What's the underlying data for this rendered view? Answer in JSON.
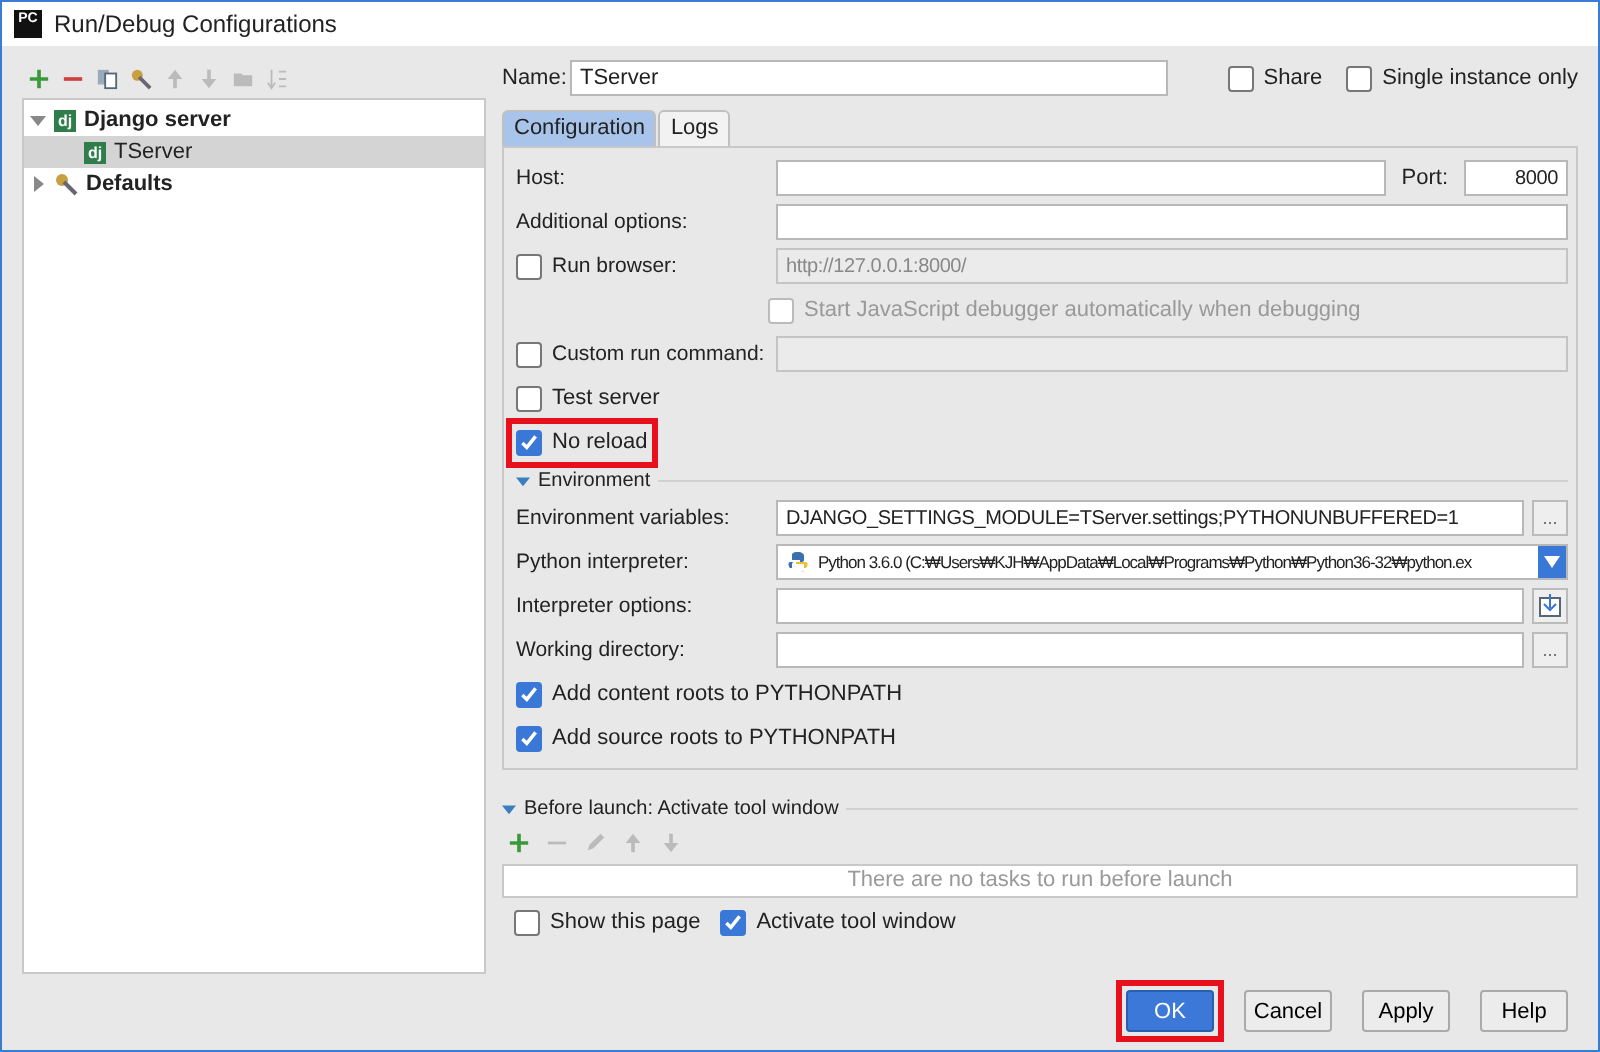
{
  "window": {
    "title": "Run/Debug Configurations",
    "icon_text": "PC"
  },
  "tree": [
    {
      "label": "Django server",
      "icon_text": "dj",
      "kind": "django",
      "expanded": true,
      "selected": false,
      "children": [
        {
          "label": "TServer",
          "icon_text": "dj",
          "kind": "django",
          "selected": true
        }
      ]
    },
    {
      "label": "Defaults",
      "kind": "defaults",
      "expanded": false,
      "selected": false
    }
  ],
  "name_field": {
    "label": "Name:",
    "value": "TServer"
  },
  "header_options": [
    {
      "label": "Share",
      "checked": false
    },
    {
      "label": "Single instance only",
      "checked": false
    }
  ],
  "tabs": [
    {
      "label": "Configuration",
      "selected": true
    },
    {
      "label": "Logs",
      "selected": false
    }
  ],
  "form": [
    {
      "kind": "host",
      "label": "Host:",
      "port_label": "Port:",
      "port_value": "8000"
    },
    {
      "kind": "field",
      "label": "Additional options:"
    },
    {
      "kind": "check_field",
      "label": "Run browser:",
      "checked": false,
      "value": "http://127.0.0.1:8000/"
    },
    {
      "kind": "subcheck",
      "label": "Start JavaScript debugger automatically when debugging",
      "checked": false
    },
    {
      "kind": "check_field",
      "label": "Custom run command:",
      "checked": false
    },
    {
      "kind": "check",
      "label": "Test server",
      "checked": false,
      "highlighted": false
    },
    {
      "kind": "check",
      "label": "No reload",
      "checked": true,
      "highlighted": true
    },
    {
      "kind": "section",
      "label": "Environment",
      "expanded": true
    },
    {
      "kind": "field",
      "label": "Environment variables:",
      "value": "DJANGO_SETTINGS_MODULE=TServer.settings;PYTHONUNBUFFERED=1",
      "button": "..."
    },
    {
      "kind": "interpreter",
      "label": "Python interpreter:",
      "value": "Python 3.6.0 (C:₩Users₩KJH₩AppData₩Local₩Programs₩Python₩Python36-32₩python.ex"
    },
    {
      "kind": "field_icon",
      "label": "Interpreter options:"
    },
    {
      "kind": "field",
      "label": "Working directory:",
      "button": "..."
    },
    {
      "kind": "check",
      "label": "Add content roots to PYTHONPATH",
      "checked": true,
      "highlighted": false
    },
    {
      "kind": "check",
      "label": "Add source roots to PYTHONPATH",
      "checked": true,
      "highlighted": false
    }
  ],
  "before_launch": {
    "title": "Before launch: Activate tool window",
    "expanded": true,
    "empty_text": "There are no tasks to run before launch"
  },
  "launch_options": [
    {
      "label": "Show this page",
      "checked": false
    },
    {
      "label": "Activate tool window",
      "checked": true
    }
  ],
  "buttons": [
    {
      "label": "OK",
      "primary": true,
      "highlighted": true
    },
    {
      "label": "Cancel",
      "primary": false,
      "highlighted": false
    },
    {
      "label": "Apply",
      "primary": false,
      "highlighted": false
    },
    {
      "label": "Help",
      "primary": false,
      "highlighted": false
    }
  ]
}
